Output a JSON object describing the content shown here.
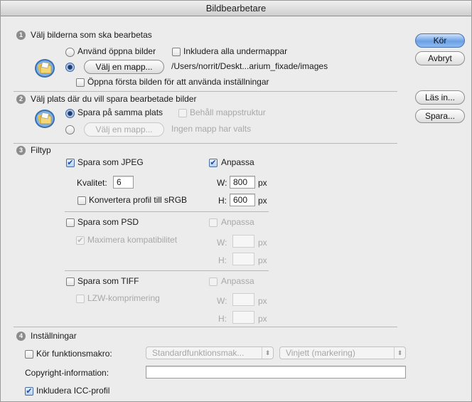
{
  "window": {
    "title": "Bildbearbetare"
  },
  "section1": {
    "number": "1",
    "title": "Välj bilderna som ska bearbetas",
    "use_open_images": "Använd öppna bilder",
    "include_subfolders": "Inkludera alla undermappar",
    "choose_folder_button": "Välj en mapp...",
    "folder_path": "/Users/norrit/Deskt...arium_fixade/images",
    "open_first_image": "Öppna första bilden för att använda inställningar"
  },
  "section2": {
    "number": "2",
    "title": "Välj plats där du vill spara bearbetade bilder",
    "save_same_place": "Spara på samma plats",
    "keep_folder_structure": "Behåll mappstruktur",
    "choose_folder_button": "Välj en mapp...",
    "no_folder_selected": "Ingen mapp har valts"
  },
  "section3": {
    "number": "3",
    "title": "Filtyp",
    "jpeg": {
      "save_label": "Spara som JPEG",
      "resize_label": "Anpassa",
      "quality_label": "Kvalitet:",
      "quality_value": "6",
      "w_label": "W:",
      "w_value": "800",
      "h_label": "H:",
      "h_value": "600",
      "unit": "px",
      "convert_profile": "Konvertera profil till sRGB"
    },
    "psd": {
      "save_label": "Spara som PSD",
      "resize_label": "Anpassa",
      "max_compat": "Maximera kompatibilitet",
      "w_label": "W:",
      "h_label": "H:",
      "unit": "px"
    },
    "tiff": {
      "save_label": "Spara som TIFF",
      "resize_label": "Anpassa",
      "lzw": "LZW-komprimering",
      "w_label": "W:",
      "h_label": "H:",
      "unit": "px"
    }
  },
  "section4": {
    "number": "4",
    "title": "Inställningar",
    "run_action_label": "Kör funktionsmakro:",
    "action_set_value": "Standardfunktionsmak...",
    "action_value": "Vinjett (markering)",
    "copyright_label": "Copyright-information:",
    "copyright_value": "",
    "include_icc": "Inkludera ICC-profil"
  },
  "side_buttons": {
    "run": "Kör",
    "cancel": "Avbryt",
    "load": "Läs in...",
    "save": "Spara..."
  },
  "icons": {
    "checkmark": "✔",
    "select_arrows": "⬍"
  }
}
